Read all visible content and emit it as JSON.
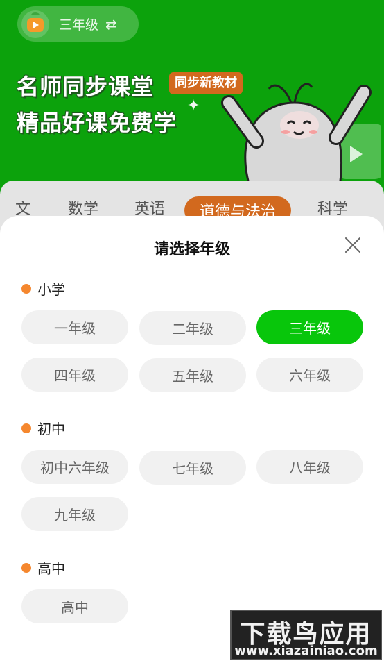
{
  "header": {
    "grade_label": "三年级",
    "swap_icon": "⇄",
    "hero_line1": "名师同步课堂",
    "hero_badge": "同步新教材",
    "hero_line2": "精品好课免费学"
  },
  "subjects": {
    "tabs": [
      "文",
      "数学",
      "英语",
      "道德与法治",
      "科学"
    ],
    "active": "道德与法治"
  },
  "sheet": {
    "title": "请选择年级",
    "sections": [
      {
        "label": "小学",
        "grades": [
          "一年级",
          "二年级",
          "三年级",
          "四年级",
          "五年级",
          "六年级"
        ]
      },
      {
        "label": "初中",
        "grades": [
          "初中六年级",
          "七年级",
          "八年级",
          "九年级"
        ]
      },
      {
        "label": "高中",
        "grades": [
          "高中"
        ]
      }
    ],
    "selected": "三年级"
  },
  "watermark": {
    "logo": "下载鸟应用",
    "url": "www.xiazainiao.com"
  },
  "colors": {
    "brand_green": "#08c60b",
    "accent_orange": "#f5872e",
    "tab_active": "#d2691e"
  }
}
